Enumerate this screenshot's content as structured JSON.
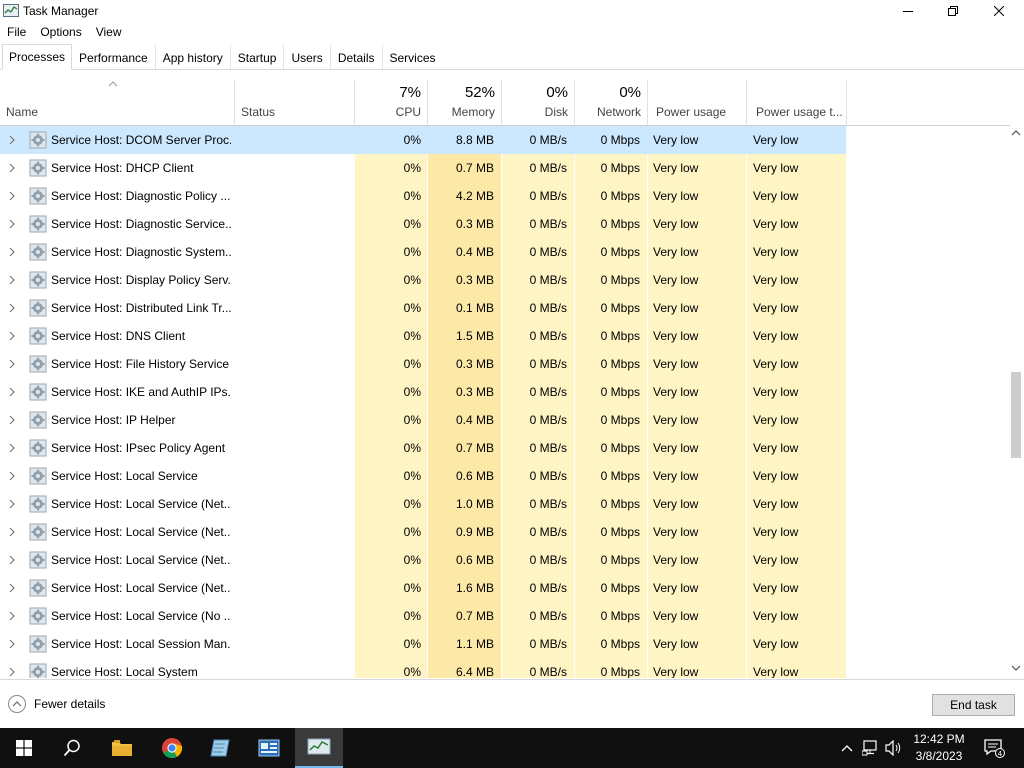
{
  "window": {
    "title": "Task Manager"
  },
  "menu": [
    "File",
    "Options",
    "View"
  ],
  "tabs": [
    "Processes",
    "Performance",
    "App history",
    "Startup",
    "Users",
    "Details",
    "Services"
  ],
  "columns": {
    "name": "Name",
    "status": "Status",
    "cpu": {
      "pct": "7%",
      "label": "CPU"
    },
    "memory": {
      "pct": "52%",
      "label": "Memory"
    },
    "disk": {
      "pct": "0%",
      "label": "Disk"
    },
    "network": {
      "pct": "0%",
      "label": "Network"
    },
    "power": "Power usage",
    "power_trend": "Power usage t..."
  },
  "rows": [
    {
      "name": "Service Host: DCOM Server Proc...",
      "cpu": "0%",
      "memory": "8.8 MB",
      "disk": "0 MB/s",
      "network": "0 Mbps",
      "power": "Very low",
      "power_trend": "Very low"
    },
    {
      "name": "Service Host: DHCP Client",
      "cpu": "0%",
      "memory": "0.7 MB",
      "disk": "0 MB/s",
      "network": "0 Mbps",
      "power": "Very low",
      "power_trend": "Very low"
    },
    {
      "name": "Service Host: Diagnostic Policy ...",
      "cpu": "0%",
      "memory": "4.2 MB",
      "disk": "0 MB/s",
      "network": "0 Mbps",
      "power": "Very low",
      "power_trend": "Very low"
    },
    {
      "name": "Service Host: Diagnostic Service...",
      "cpu": "0%",
      "memory": "0.3 MB",
      "disk": "0 MB/s",
      "network": "0 Mbps",
      "power": "Very low",
      "power_trend": "Very low"
    },
    {
      "name": "Service Host: Diagnostic System...",
      "cpu": "0%",
      "memory": "0.4 MB",
      "disk": "0 MB/s",
      "network": "0 Mbps",
      "power": "Very low",
      "power_trend": "Very low"
    },
    {
      "name": "Service Host: Display Policy Serv...",
      "cpu": "0%",
      "memory": "0.3 MB",
      "disk": "0 MB/s",
      "network": "0 Mbps",
      "power": "Very low",
      "power_trend": "Very low"
    },
    {
      "name": "Service Host: Distributed Link Tr...",
      "cpu": "0%",
      "memory": "0.1 MB",
      "disk": "0 MB/s",
      "network": "0 Mbps",
      "power": "Very low",
      "power_trend": "Very low"
    },
    {
      "name": "Service Host: DNS Client",
      "cpu": "0%",
      "memory": "1.5 MB",
      "disk": "0 MB/s",
      "network": "0 Mbps",
      "power": "Very low",
      "power_trend": "Very low"
    },
    {
      "name": "Service Host: File History Service",
      "cpu": "0%",
      "memory": "0.3 MB",
      "disk": "0 MB/s",
      "network": "0 Mbps",
      "power": "Very low",
      "power_trend": "Very low"
    },
    {
      "name": "Service Host: IKE and AuthIP IPs...",
      "cpu": "0%",
      "memory": "0.3 MB",
      "disk": "0 MB/s",
      "network": "0 Mbps",
      "power": "Very low",
      "power_trend": "Very low"
    },
    {
      "name": "Service Host: IP Helper",
      "cpu": "0%",
      "memory": "0.4 MB",
      "disk": "0 MB/s",
      "network": "0 Mbps",
      "power": "Very low",
      "power_trend": "Very low"
    },
    {
      "name": "Service Host: IPsec Policy Agent",
      "cpu": "0%",
      "memory": "0.7 MB",
      "disk": "0 MB/s",
      "network": "0 Mbps",
      "power": "Very low",
      "power_trend": "Very low"
    },
    {
      "name": "Service Host: Local Service",
      "cpu": "0%",
      "memory": "0.6 MB",
      "disk": "0 MB/s",
      "network": "0 Mbps",
      "power": "Very low",
      "power_trend": "Very low"
    },
    {
      "name": "Service Host: Local Service (Net...",
      "cpu": "0%",
      "memory": "1.0 MB",
      "disk": "0 MB/s",
      "network": "0 Mbps",
      "power": "Very low",
      "power_trend": "Very low"
    },
    {
      "name": "Service Host: Local Service (Net...",
      "cpu": "0%",
      "memory": "0.9 MB",
      "disk": "0 MB/s",
      "network": "0 Mbps",
      "power": "Very low",
      "power_trend": "Very low"
    },
    {
      "name": "Service Host: Local Service (Net...",
      "cpu": "0%",
      "memory": "0.6 MB",
      "disk": "0 MB/s",
      "network": "0 Mbps",
      "power": "Very low",
      "power_trend": "Very low"
    },
    {
      "name": "Service Host: Local Service (Net...",
      "cpu": "0%",
      "memory": "1.6 MB",
      "disk": "0 MB/s",
      "network": "0 Mbps",
      "power": "Very low",
      "power_trend": "Very low"
    },
    {
      "name": "Service Host: Local Service (No ...",
      "cpu": "0%",
      "memory": "0.7 MB",
      "disk": "0 MB/s",
      "network": "0 Mbps",
      "power": "Very low",
      "power_trend": "Very low"
    },
    {
      "name": "Service Host: Local Session Man...",
      "cpu": "0%",
      "memory": "1.1 MB",
      "disk": "0 MB/s",
      "network": "0 Mbps",
      "power": "Very low",
      "power_trend": "Very low"
    },
    {
      "name": "Service Host: Local System",
      "cpu": "0%",
      "memory": "6.4 MB",
      "disk": "0 MB/s",
      "network": "0 Mbps",
      "power": "Very low",
      "power_trend": "Very low"
    }
  ],
  "footer": {
    "fewer_details": "Fewer details",
    "end_task": "End task"
  },
  "taskbar": {
    "time": "12:42 PM",
    "date": "3/8/2023",
    "notification_count": "4",
    "apps": [
      "start-icon",
      "search-icon",
      "file-explorer-icon",
      "chrome-icon",
      "notepad-icon",
      "network-app-icon",
      "task-manager-icon"
    ]
  },
  "colors": {
    "selected_row": "#cce8ff",
    "heat_light": "#fff4c4",
    "heat_dark": "#fce9a8",
    "taskbar": "#101010",
    "accent": "#76b9ed"
  }
}
